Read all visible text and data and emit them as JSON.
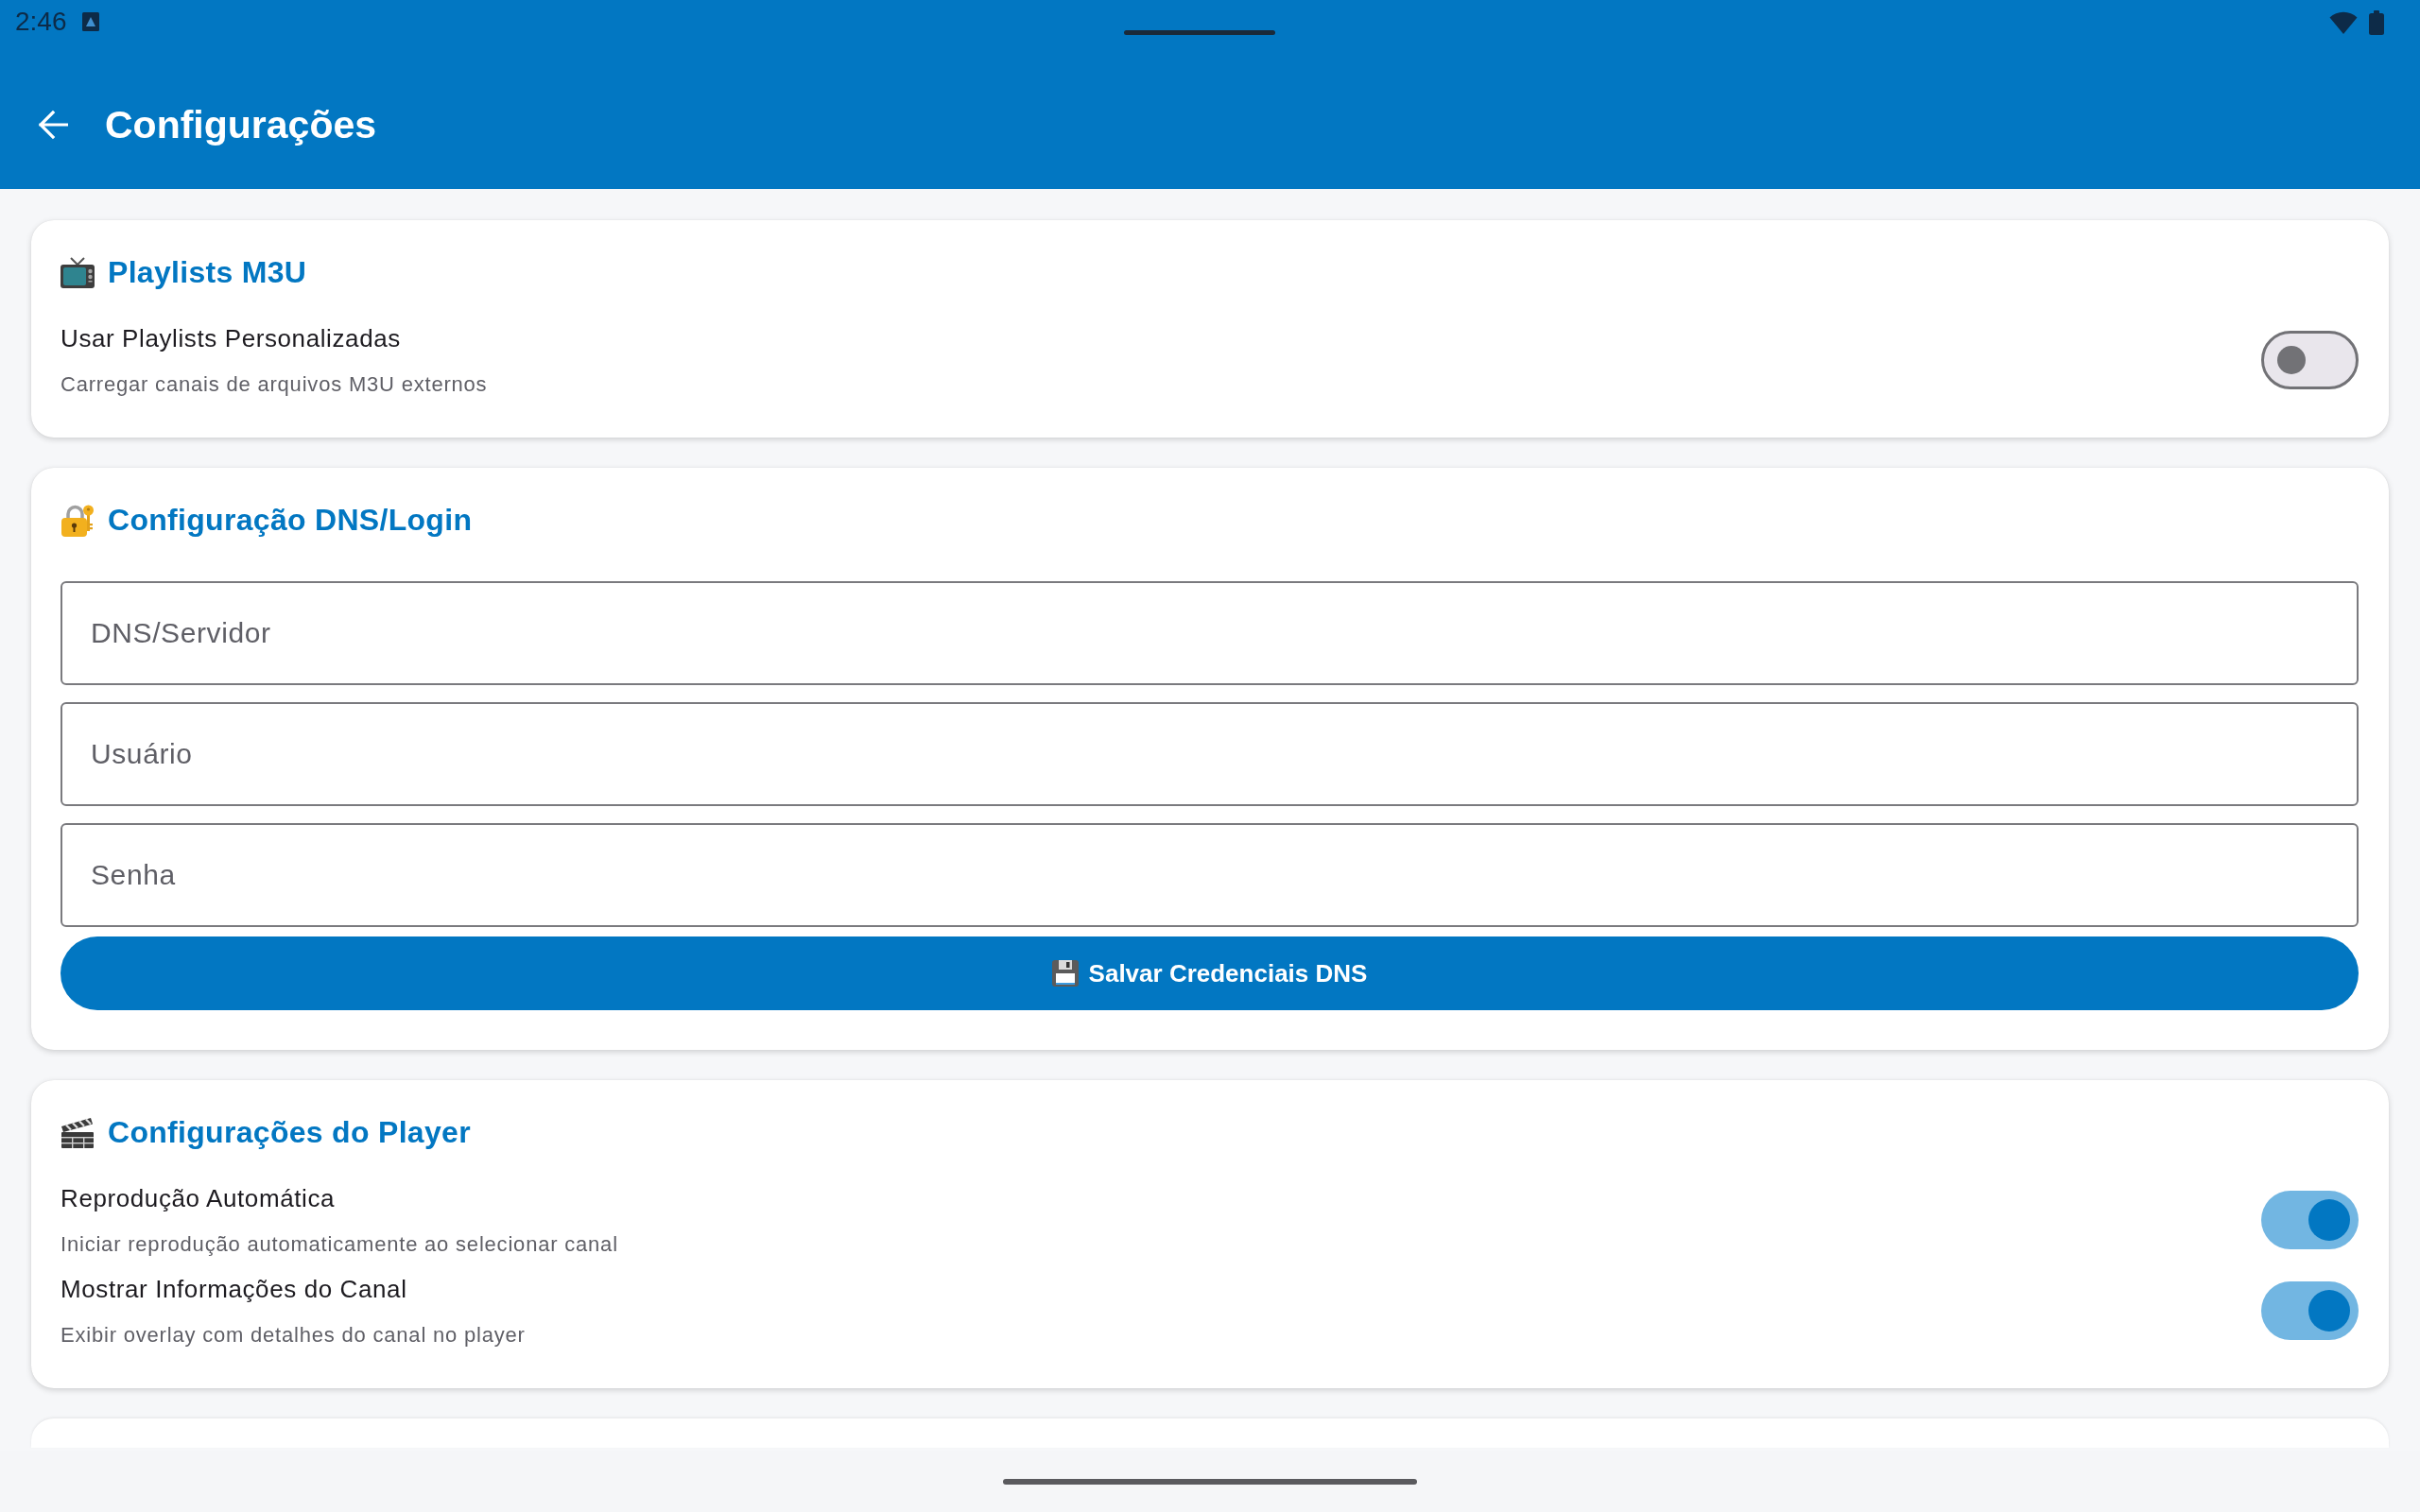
{
  "status_bar": {
    "time": "2:46"
  },
  "app_bar": {
    "title": "Configurações"
  },
  "playlists_card": {
    "title": "Playlists M3U",
    "settings": [
      {
        "label": "Usar Playlists Personalizadas",
        "description": "Carregar canais de arquivos M3U externos",
        "on": false
      }
    ]
  },
  "dns_card": {
    "title": "Configuração DNS/Login",
    "fields": [
      {
        "placeholder": "DNS/Servidor"
      },
      {
        "placeholder": "Usuário"
      },
      {
        "placeholder": "Senha"
      }
    ],
    "save_button": {
      "label": "Salvar Credenciais DNS"
    }
  },
  "player_card": {
    "title": "Configurações do Player",
    "settings": [
      {
        "label": "Reprodução Automática",
        "description": "Iniciar reprodução automaticamente ao selecionar canal",
        "on": true
      },
      {
        "label": "Mostrar Informações do Canal",
        "description": "Exibir overlay com detalhes do canal no player",
        "on": true
      }
    ]
  }
}
